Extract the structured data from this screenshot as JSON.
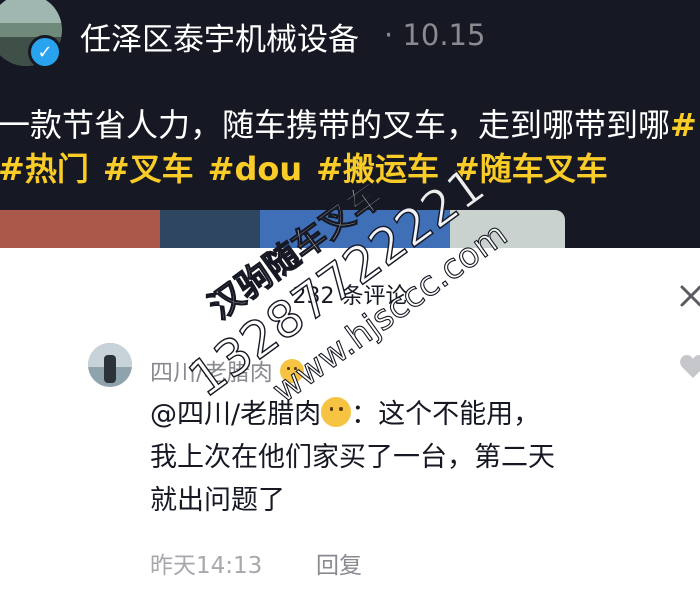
{
  "post": {
    "author_name": "任泽区泰宇机械设备",
    "separator": "·",
    "post_time": "10.15",
    "caption_text": "一款节省人力，随车携带的叉车，走到哪带到哪",
    "caption_overflow_tag": "#",
    "hashtags": [
      "#热门",
      "#叉车",
      "#dou",
      "#搬运车",
      "#随车叉车"
    ]
  },
  "comments_panel": {
    "count_label": "232 条评论",
    "comment": {
      "author_name": "四川/老腊肉",
      "mention": "@四川/老腊肉",
      "text_after_mention": "：这个不能用，",
      "text_line2": "我上次在他们家买了一台，第二天",
      "text_line3": "就出问题了",
      "time": "昨天14:13",
      "reply_label": "回复"
    }
  },
  "watermark": {
    "line1": "汉驹随车叉车",
    "line2": "13287722221",
    "line3": "www.hjsccc.com"
  },
  "colors": {
    "video_bg": "#161823",
    "hashtag": "#facc27",
    "verified": "#2aa3ef"
  },
  "icons": [
    "verified-icon",
    "close-icon",
    "like-icon",
    "emoji-hug-icon"
  ]
}
